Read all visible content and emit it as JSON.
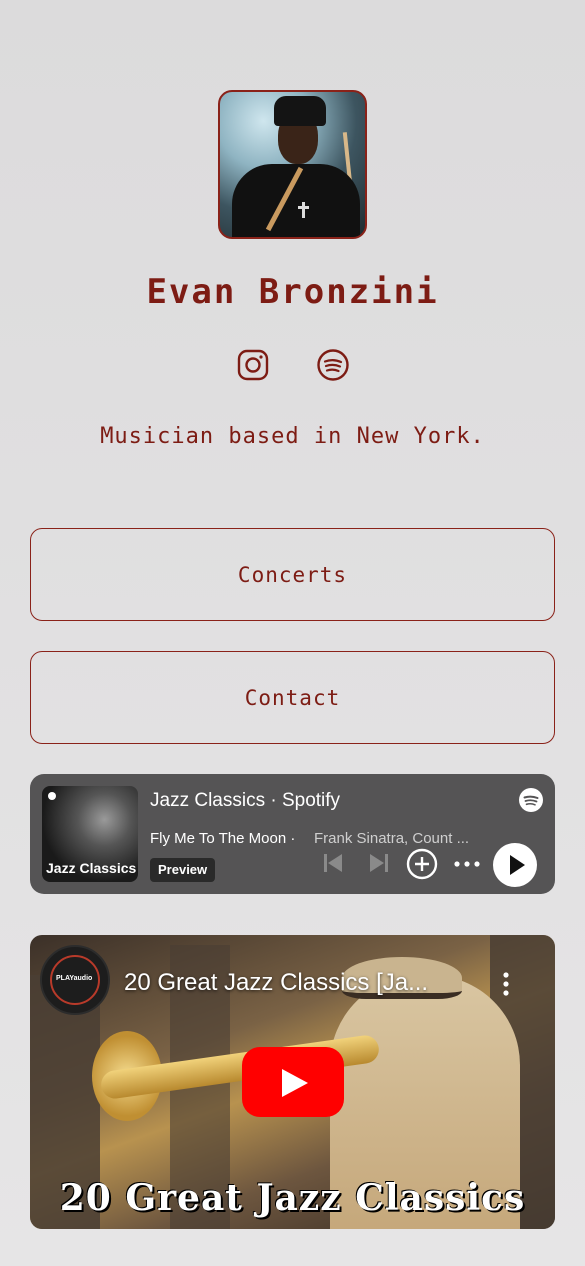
{
  "profile": {
    "name": "Evan Bronzini",
    "bio": "Musician based in New York.",
    "accent_color": "#7d1c14",
    "avatar_icon": "avatar-photo"
  },
  "socials": [
    {
      "name": "instagram",
      "icon": "instagram-icon"
    },
    {
      "name": "spotify",
      "icon": "spotify-icon"
    }
  ],
  "links": {
    "concerts": "Concerts",
    "contact": "Contact"
  },
  "spotify_embed": {
    "title": "Jazz Classics · Spotify",
    "cover_label": "Jazz Classics",
    "track": "Fly Me To The Moon",
    "separator": "·",
    "artist": "Frank Sinatra, Count ...",
    "preview_badge": "Preview"
  },
  "video_embed": {
    "title": "20 Great Jazz Classics [Ja...",
    "caption": "20 Great Jazz Classics",
    "channel_logo_text": "PLAYaudio"
  }
}
